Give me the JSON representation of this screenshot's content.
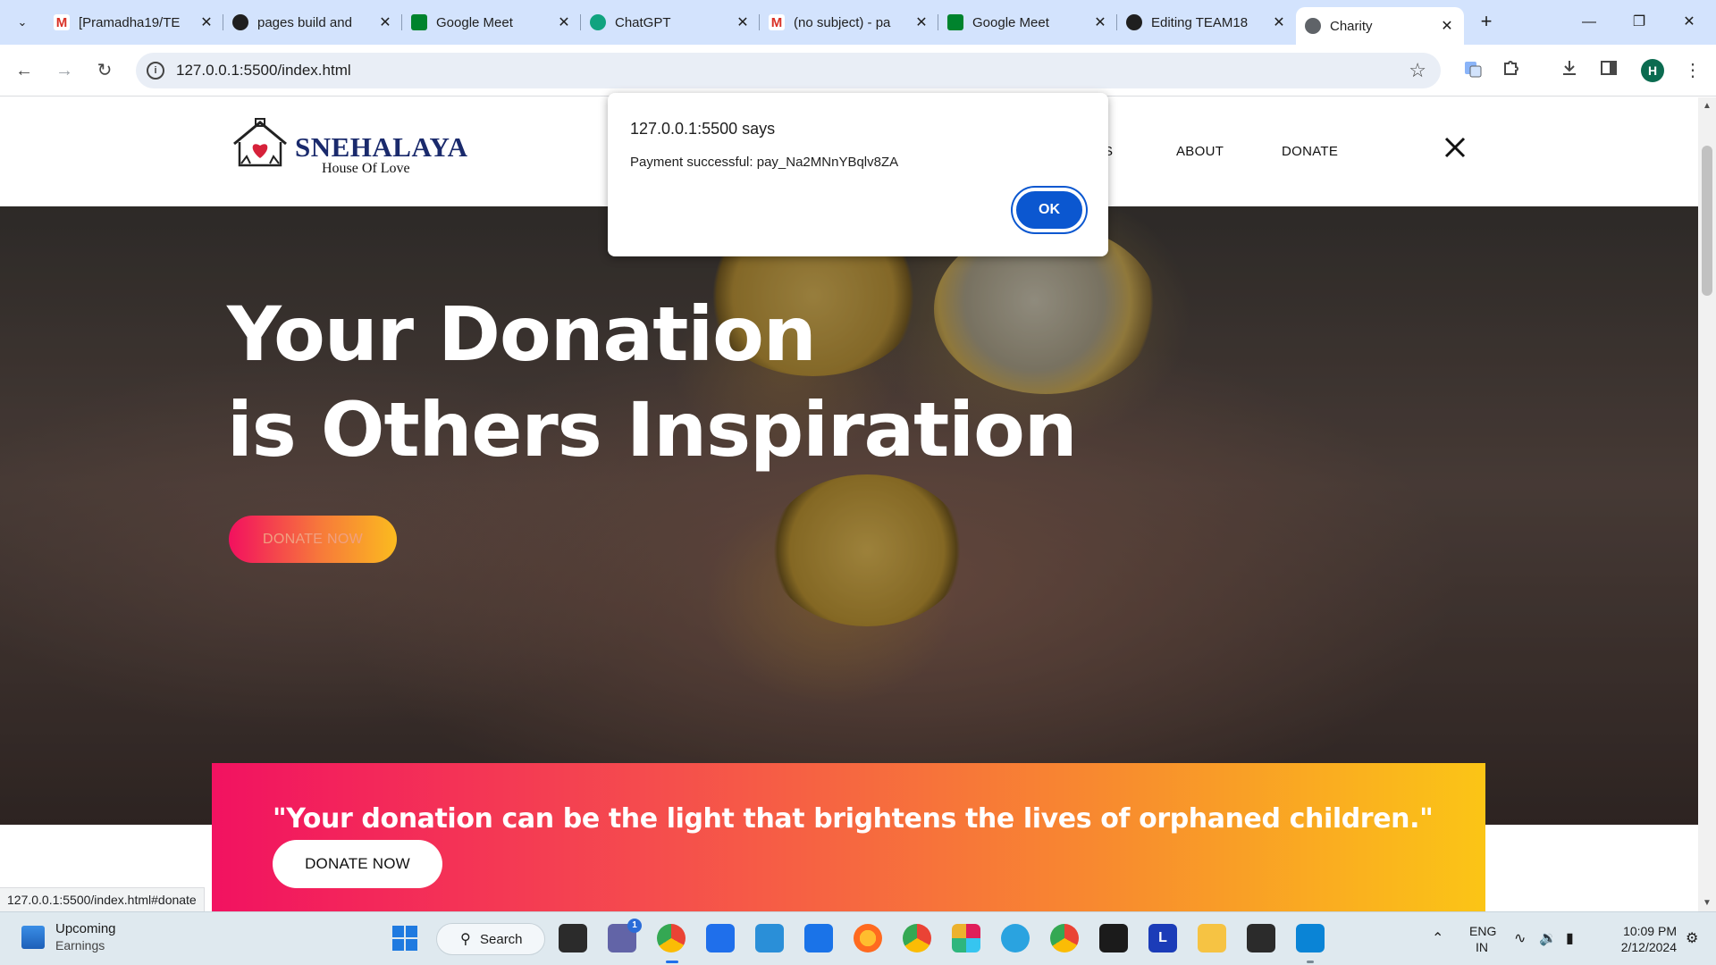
{
  "browser": {
    "tabs": [
      {
        "title": "[Pramadha19/TE",
        "favicon": "gmail-icon"
      },
      {
        "title": "pages build and",
        "favicon": "github-icon"
      },
      {
        "title": "Google Meet",
        "favicon": "google-meet-icon"
      },
      {
        "title": "ChatGPT",
        "favicon": "chatgpt-icon"
      },
      {
        "title": "(no subject) - pa",
        "favicon": "gmail-icon"
      },
      {
        "title": "Google Meet",
        "favicon": "google-meet-icon"
      },
      {
        "title": "Editing TEAM18",
        "favicon": "github-icon"
      },
      {
        "title": "Charity",
        "favicon": "globe-icon",
        "active": true
      }
    ],
    "url": "127.0.0.1:5500/index.html",
    "profile_initial": "H",
    "status_url": "127.0.0.1:5500/index.html#donate"
  },
  "site": {
    "logo": {
      "name": "SNEHALAYA",
      "tagline": "House Of Love",
      "mark_text": "SNEHALAYA"
    },
    "nav": {
      "partial_item": "S",
      "about": "ABOUT",
      "donate": "DONATE"
    },
    "hero": {
      "line1": "Your Donation",
      "line2": "is Others Inspiration",
      "button": "DONATE NOW"
    },
    "promo": {
      "quote": "\"Your donation can be the light that brightens the lives of orphaned children.\"",
      "button": "DONATE NOW"
    }
  },
  "dialog": {
    "title": "127.0.0.1:5500 says",
    "message": "Payment successful: pay_Na2MNnYBqlv8ZA",
    "ok": "OK"
  },
  "taskbar": {
    "weather_title": "Upcoming",
    "weather_sub": "Earnings",
    "search": "Search",
    "chat_badge": "1",
    "lang_top": "ENG",
    "lang_bottom": "IN",
    "time": "10:09 PM",
    "date": "2/12/2024"
  },
  "colors": {
    "brand_navy": "#1a2a6c",
    "gradient_pink": "#f21261",
    "gradient_orange": "#f88a2f",
    "gradient_yellow": "#fbc516",
    "dialog_blue": "#0b57d0",
    "tab_strip": "#d3e3fd"
  }
}
